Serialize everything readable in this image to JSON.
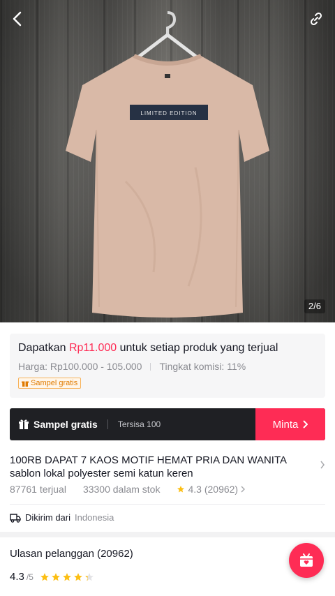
{
  "hero": {
    "shirt_print": "LIMITED EDITION",
    "counter": "2/6"
  },
  "commission": {
    "prefix": "Dapatkan ",
    "amount": "Rp11.000",
    "suffix": " untuk setiap produk yang terjual",
    "price": "Harga: Rp100.000 - 105.000",
    "rate": "Tingkat komisi: 11%",
    "badge": "Sampel gratis"
  },
  "sample_bar": {
    "label": "Sampel gratis",
    "remaining": "Tersisa 100",
    "request": "Minta"
  },
  "product": {
    "title": "100RB DAPAT 7 KAOS MOTIF HEMAT PRIA DAN WANITA sablon lokal polyester semi katun keren",
    "sold": "87761 terjual",
    "stock": "33300 dalam stok",
    "rating": "4.3 (20962)"
  },
  "shipping": {
    "label": "Dikirim dari",
    "country": "Indonesia"
  },
  "reviews": {
    "title": "Ulasan pelanggan (20962)",
    "score": "4.3",
    "out_of": "/5",
    "stars_value": 4.3
  },
  "colors": {
    "accent": "#fe2c55",
    "dark_bar": "#1f2024",
    "star": "#fcbf14"
  },
  "icons": [
    "back-icon",
    "share-link-icon",
    "gift-icon",
    "chevron-right-icon",
    "star-icon",
    "truck-icon",
    "live-shop-icon"
  ]
}
